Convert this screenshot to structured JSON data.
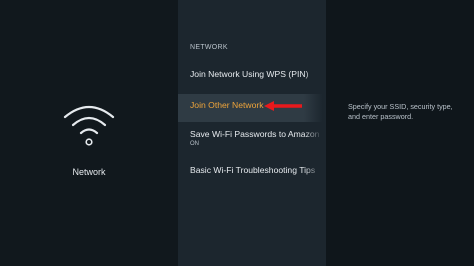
{
  "left_panel": {
    "icon": "wifi-icon",
    "label": "Network"
  },
  "menu": {
    "section_title": "NETWORK",
    "items": [
      {
        "label": "Join Network Using WPS (PIN)",
        "sublabel": ""
      },
      {
        "label": "Join Other Network",
        "sublabel": "",
        "selected": true
      },
      {
        "label": "Save Wi-Fi Passwords to Amazon",
        "sublabel": "ON"
      },
      {
        "label": "Basic Wi-Fi Troubleshooting Tips",
        "sublabel": ""
      }
    ]
  },
  "help": {
    "text": "Specify your SSID, security type, and enter password."
  },
  "colors": {
    "background": "#0f161b",
    "menu_panel": "#1c262e",
    "selected_row": "#2f3b44",
    "selected_text": "#f0a53a",
    "annotation_arrow": "#e8191c"
  }
}
